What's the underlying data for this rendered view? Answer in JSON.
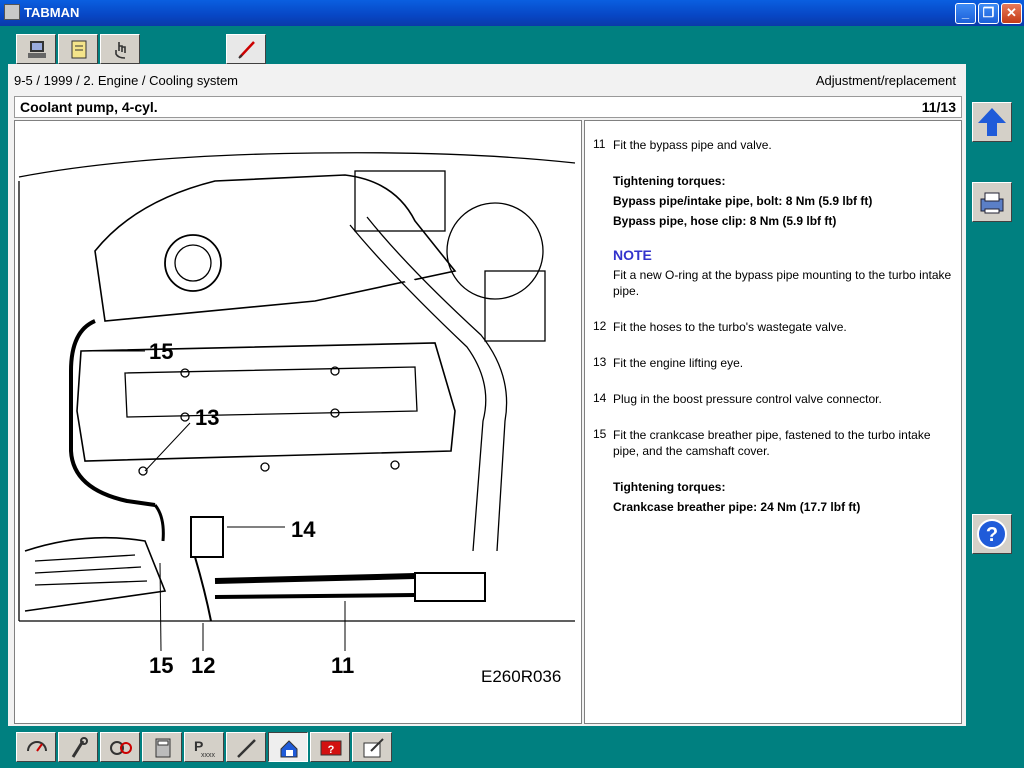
{
  "window": {
    "title": "TABMAN"
  },
  "breadcrumb": "9-5 / 1999 / 2. Engine / Cooling system",
  "section": "Adjustment/replacement",
  "header": {
    "title": "Coolant pump, 4-cyl.",
    "page": "11/13"
  },
  "diagram": {
    "callouts": [
      "15",
      "13",
      "14",
      "15",
      "12",
      "11"
    ],
    "code": "E260R036"
  },
  "steps": [
    {
      "num": "11",
      "text": "Fit the bypass pipe and valve."
    },
    {
      "num": "12",
      "text": "Fit the hoses to the turbo's wastegate valve."
    },
    {
      "num": "13",
      "text": "Fit the engine lifting eye."
    },
    {
      "num": "14",
      "text": "Plug in the boost pressure control valve connector."
    },
    {
      "num": "15",
      "text": "Fit the crankcase breather pipe, fastened to the turbo intake pipe, and the camshaft cover."
    }
  ],
  "torque1": {
    "heading": "Tightening torques:",
    "line1": "Bypass pipe/intake pipe, bolt: 8 Nm (5.9 lbf ft)",
    "line2": "Bypass pipe, hose clip: 8 Nm (5.9 lbf ft)"
  },
  "note": {
    "heading": "NOTE",
    "text": "Fit a new O-ring at the bypass pipe mounting to the turbo intake pipe."
  },
  "torque2": {
    "heading": "Tightening torques:",
    "line1": "Crankcase breather pipe: 24 Nm (17.7 lbf ft)"
  },
  "icons": {
    "top_tabs": [
      "computer-icon",
      "document-icon",
      "hand-pointer-icon",
      "edit-pen-icon"
    ],
    "side": [
      "up-arrow-icon",
      "print-icon",
      "help-icon"
    ],
    "zoom": [
      "zoom-in-icon",
      "zoom-out-icon",
      "fit-view-icon"
    ],
    "nav": [
      "fit-view-icon",
      "previous-page-icon",
      "next-page-icon"
    ],
    "bottom": [
      "gauge-icon",
      "wrench-icon",
      "diagnostics-icon",
      "calculator-icon",
      "parts-icon",
      "pencil-icon",
      "vehicle-icon",
      "fault-icon",
      "notes-icon"
    ]
  },
  "colors": {
    "desktop": "#008080",
    "accent": "#0a5fe0",
    "note": "#3333cc"
  }
}
